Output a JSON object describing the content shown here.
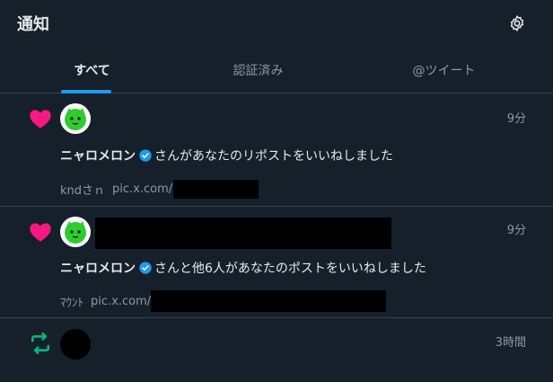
{
  "header": {
    "title": "通知"
  },
  "tabs": [
    {
      "label": "すべて"
    },
    {
      "label": "認証済み"
    },
    {
      "label": "@ツイート"
    }
  ],
  "notifications": [
    {
      "type": "like",
      "time": "9分",
      "user": "ニャロメロン",
      "action": "さんがあなたのリポストをいいねしました",
      "preview_prefix": "kndさｎ",
      "preview_link": "pic.x.com/"
    },
    {
      "type": "like",
      "time": "9分",
      "user": "ニャロメロン",
      "action": "さんと他6人があなたのポストをいいねしました",
      "preview_prefix": "ﾏｳﾝﾄ",
      "preview_link": "pic.x.com/"
    },
    {
      "type": "repost",
      "time": "3時間"
    }
  ],
  "colors": {
    "background": "#15202b",
    "accent": "#1d9bf0",
    "like": "#f91880",
    "repost": "#00ba7c"
  }
}
